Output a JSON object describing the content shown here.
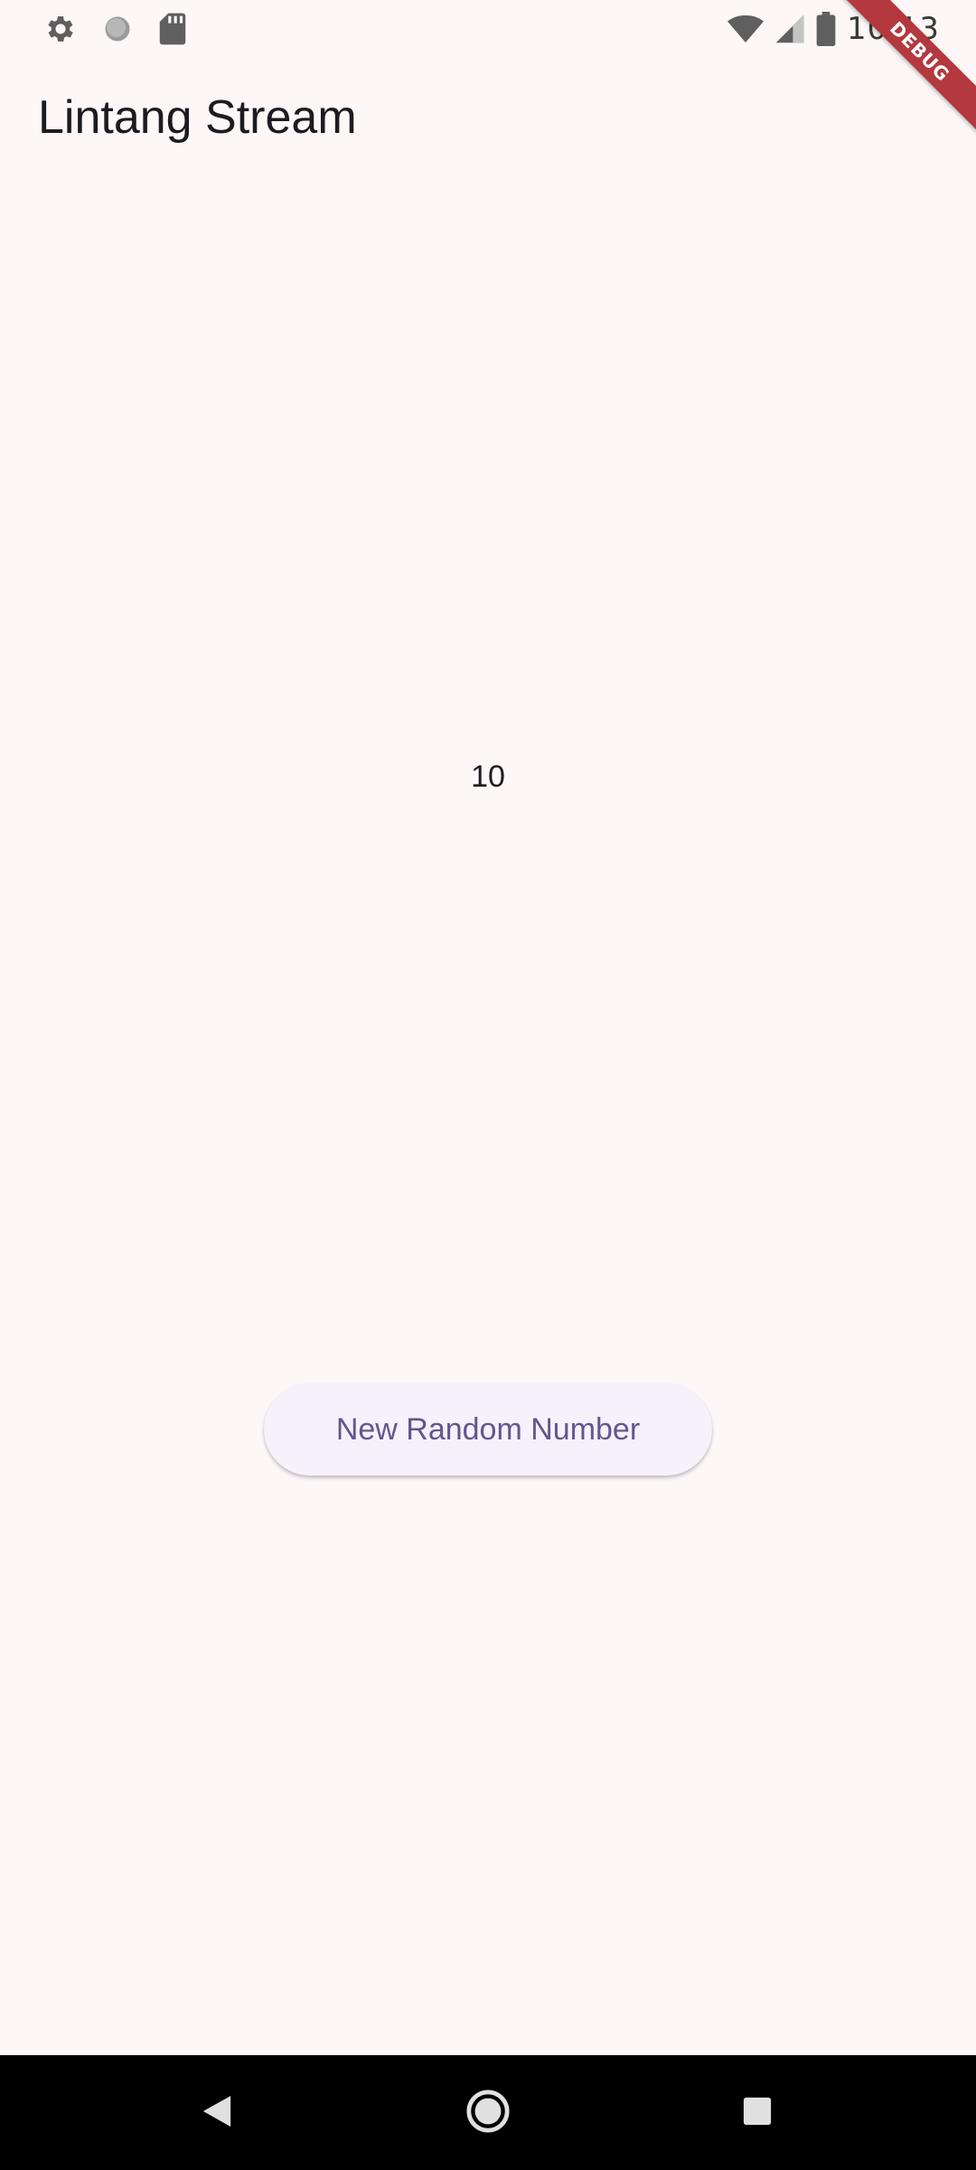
{
  "status_bar": {
    "time": "10:13",
    "left_icons": [
      "gear-icon",
      "circle-icon",
      "sd-card-icon"
    ],
    "right_icons": [
      "wifi-icon",
      "signal-icon",
      "battery-icon"
    ]
  },
  "debug_banner": {
    "label": "DEBUG",
    "color": "#b3393f"
  },
  "app_bar": {
    "title": "Lintang Stream"
  },
  "main": {
    "number": "10",
    "button_label": "New Random Number",
    "button_text_color": "#65558f"
  },
  "nav_bar": {
    "icons": [
      "back-icon",
      "home-icon",
      "recents-icon"
    ]
  }
}
